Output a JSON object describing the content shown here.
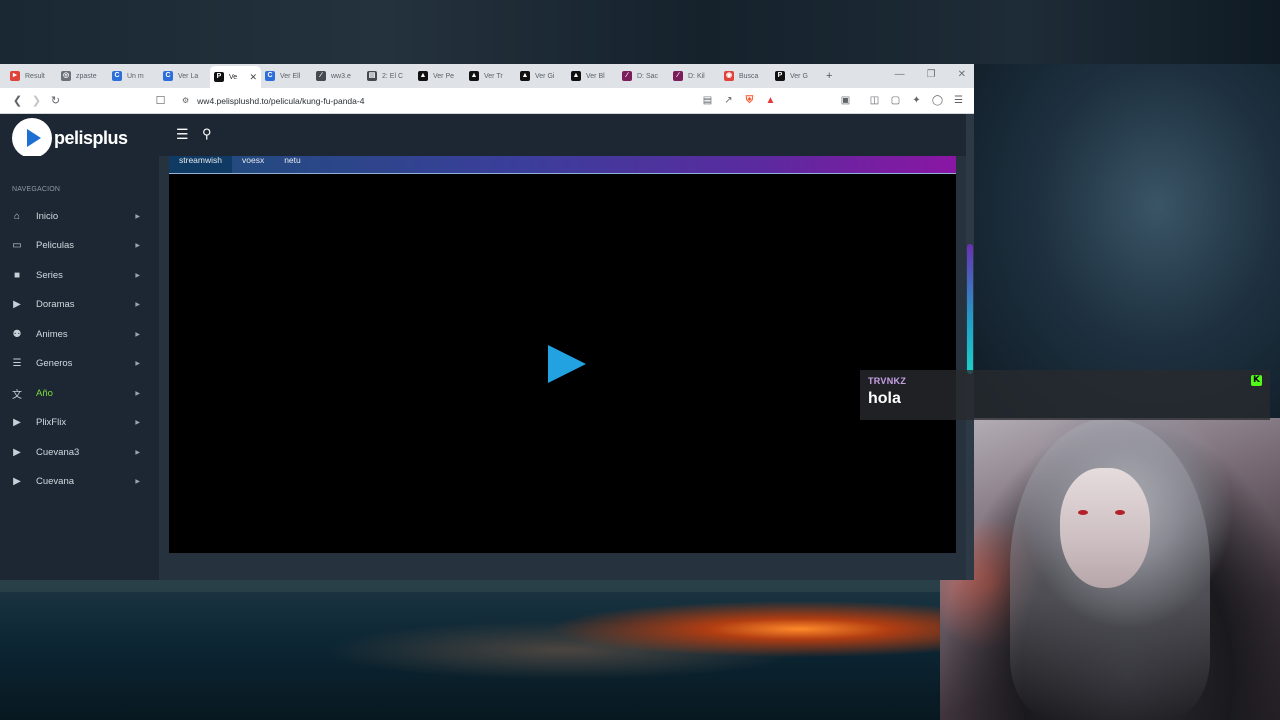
{
  "browser": {
    "tabs": [
      {
        "label": "Result",
        "icon": "opera-icon",
        "color": "#e0433b",
        "glyph": "►"
      },
      {
        "label": "zpaste",
        "icon": "globe-icon",
        "color": "#6b7178",
        "glyph": "◎"
      },
      {
        "label": "Un m",
        "icon": "cuevana-c-icon",
        "color": "#2d6fd8",
        "glyph": "C"
      },
      {
        "label": "Ver La",
        "icon": "cuevana-c-icon",
        "color": "#2d6fd8",
        "glyph": "C"
      },
      {
        "label": "Ve",
        "icon": "pelisplus-p-icon",
        "color": "#111111",
        "glyph": "P"
      },
      {
        "label": "Ver Ell",
        "icon": "cuevana-c-icon",
        "color": "#2d6fd8",
        "glyph": "C"
      },
      {
        "label": "ww3.e",
        "icon": "chart-icon",
        "color": "#444a50",
        "glyph": "∕"
      },
      {
        "label": "2: El C",
        "icon": "document-icon",
        "color": "#444a50",
        "glyph": "▤"
      },
      {
        "label": "Ver Pe",
        "icon": "triangle-icon",
        "color": "#111111",
        "glyph": "▲"
      },
      {
        "label": "Ver Tr",
        "icon": "triangle-icon",
        "color": "#111111",
        "glyph": "▲"
      },
      {
        "label": "Ver Gi",
        "icon": "triangle-icon",
        "color": "#111111",
        "glyph": "▲"
      },
      {
        "label": "Ver Bl",
        "icon": "triangle-icon",
        "color": "#111111",
        "glyph": "▲"
      },
      {
        "label": "D: Sac",
        "icon": "chart-icon",
        "color": "#7a1d5a",
        "glyph": "∕"
      },
      {
        "label": "D: Kil",
        "icon": "chart-icon",
        "color": "#7a1d5a",
        "glyph": "∕"
      },
      {
        "label": "Busca",
        "icon": "video-icon",
        "color": "#e0433b",
        "glyph": "◉"
      },
      {
        "label": "Ver G",
        "icon": "pelisplus-p-icon",
        "color": "#111111",
        "glyph": "P"
      }
    ],
    "active_tab_index": 4,
    "new_tab": "+",
    "url": "ww4.pelisplushd.to/pelicula/kung-fu-panda-4"
  },
  "site": {
    "brand": "pelisplus",
    "nav_heading": "NAVEGACION",
    "nav_items": [
      {
        "label": "Inicio",
        "icon": "home-icon",
        "glyph": "⌂"
      },
      {
        "label": "Peliculas",
        "icon": "monitor-icon",
        "glyph": "▭"
      },
      {
        "label": "Series",
        "icon": "video-camera-icon",
        "glyph": "■"
      },
      {
        "label": "Doramas",
        "icon": "play-icon",
        "glyph": "▶"
      },
      {
        "label": "Animes",
        "icon": "robot-icon",
        "glyph": "⚉"
      },
      {
        "label": "Generos",
        "icon": "list-icon",
        "glyph": "☰"
      },
      {
        "label": "Año",
        "icon": "translate-icon",
        "glyph": "文"
      },
      {
        "label": "PlixFlix",
        "icon": "play-icon",
        "glyph": "▶"
      },
      {
        "label": "Cuevana3",
        "icon": "play-icon",
        "glyph": "▶"
      },
      {
        "label": "Cuevana",
        "icon": "play-icon",
        "glyph": "▶"
      }
    ],
    "active_nav_index": 6,
    "servers": [
      "streamwish",
      "voesx",
      "netu"
    ],
    "active_server_index": 0
  },
  "chat": {
    "username": "TRVNKZ",
    "message": "hola",
    "badge": "K",
    "badge_color": "#53fc18"
  },
  "colors": {
    "accent_active": "#7ddc3b",
    "play_button": "#22a2e0"
  }
}
